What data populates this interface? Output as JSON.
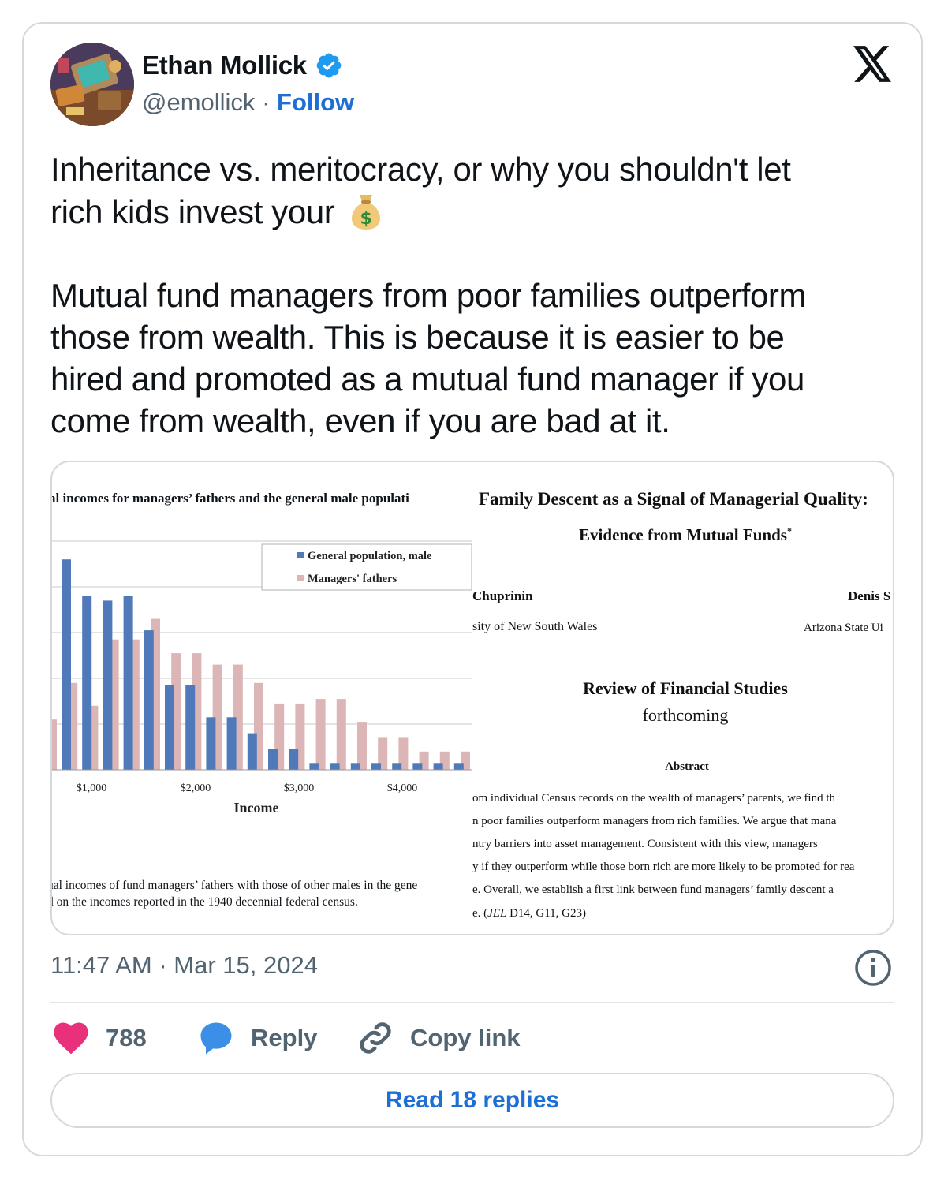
{
  "author": {
    "name": "Ethan Mollick",
    "handle": "@emollick",
    "separator": "·",
    "follow_label": "Follow"
  },
  "tweet": {
    "line1": "Inheritance vs. meritocracy, or why you shouldn't let",
    "line2": "rich kids invest your",
    "emoji": "money-bag-emoji",
    "paragraph2": "Mutual fund managers from poor families outperform\nthose from wealth. This is because it is easier to be\nhired and promoted as a mutual fund manager if you\ncome from wealth, even if you are bad at it."
  },
  "media": {
    "left": {
      "figure_title": "al incomes for managers’ fathers and the general male populati",
      "caption_line1": "ual incomes of fund managers’ fathers with those of other males in the gene",
      "caption_line2": "d on the incomes reported in the 1940 decennial federal census."
    },
    "right": {
      "title": "Family Descent as a Signal of Managerial Quality:",
      "subtitle": "Evidence from Mutual Funds",
      "subtitle_mark": "*",
      "author1": "Chuprinin",
      "author2": "Denis S",
      "affiliation1": "sity of New South Wales",
      "affiliation2": "Arizona State Ui",
      "journal": "Review of Financial Studies",
      "status": "forthcoming",
      "abstract_heading": "Abstract",
      "abstract_lines": [
        "om individual Census records on the wealth of managers’ parents, we find th",
        "n poor families outperform managers from rich families. We argue that mana",
        "ntry barriers into asset management. Consistent with this view, managers",
        "y if they outperform while those born rich are more likely to be promoted for rea",
        "e. Overall, we establish a first link between fund managers’ family descent a"
      ],
      "jel_prefix": "e. (",
      "jel_italic": "JEL",
      "jel_codes": " D14, G11, G23)"
    }
  },
  "chart_data": {
    "type": "bar",
    "xlabel": "Income",
    "x_tick_labels": [
      "$1,000",
      "$2,000",
      "$3,000",
      "$4,000"
    ],
    "legend_position": "top-right",
    "grid": true,
    "series": [
      {
        "name": "General population, male",
        "color": "#4f79b8",
        "values": [
          0.92,
          0.76,
          0.74,
          0.76,
          0.61,
          0.37,
          0.37,
          0.23,
          0.23,
          0.16,
          0.09,
          0.09,
          0.03,
          0.03,
          0.03,
          0.03,
          0.03,
          0.03,
          0.03,
          0.03
        ]
      },
      {
        "name": "Managers' fathers",
        "color": "#dcb6b6",
        "values": [
          0.22,
          0.38,
          0.28,
          0.57,
          0.57,
          0.66,
          0.51,
          0.51,
          0.46,
          0.46,
          0.38,
          0.29,
          0.29,
          0.31,
          0.31,
          0.21,
          0.14,
          0.14,
          0.08,
          0.08,
          0.08
        ]
      }
    ]
  },
  "footer": {
    "time": "11:47 AM",
    "separator": "·",
    "date": "Mar 15, 2024",
    "likes": "788",
    "reply_label": "Reply",
    "copy_link_label": "Copy link",
    "read_replies_label": "Read 18 replies"
  },
  "colors": {
    "accent": "#1d6fd6",
    "like": "#e8307b",
    "reply_bubble": "#3b8fe6",
    "muted_text": "#536471"
  }
}
